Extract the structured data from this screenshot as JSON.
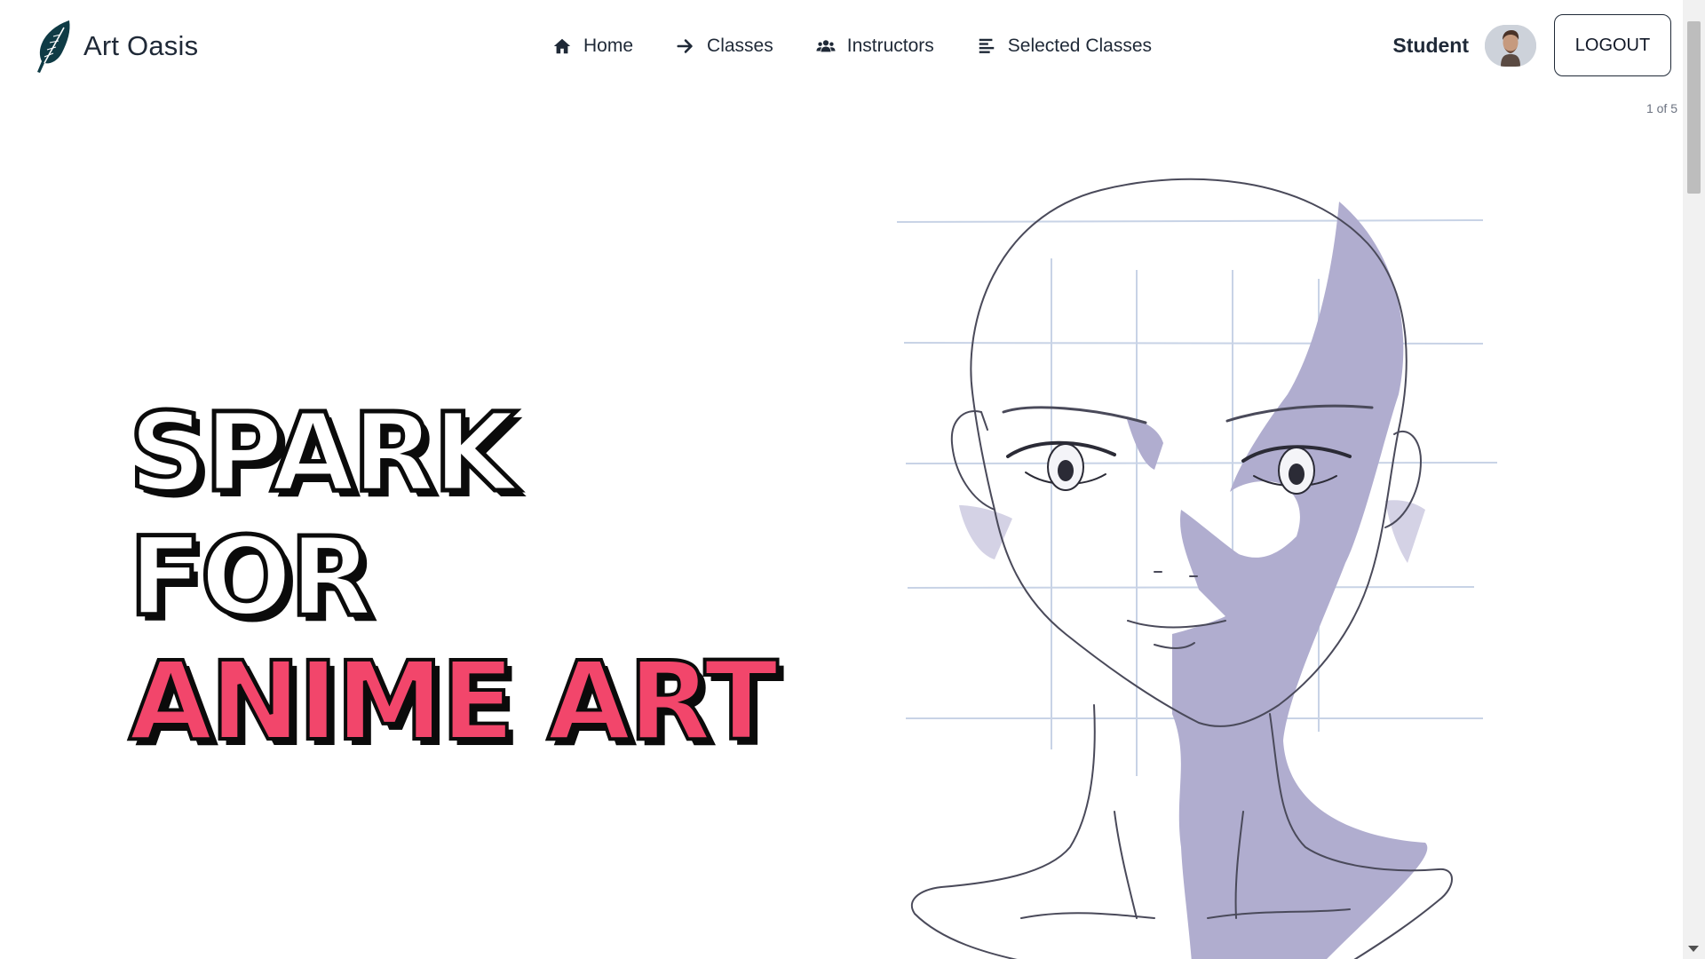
{
  "brand": {
    "name": "Art Oasis",
    "logo_icon": "feather-icon",
    "logo_color": "#0f3b45"
  },
  "nav": {
    "items": [
      {
        "label": "Home",
        "icon": "home-icon"
      },
      {
        "label": "Classes",
        "icon": "arrow-right-icon"
      },
      {
        "label": "Instructors",
        "icon": "users-icon"
      },
      {
        "label": "Selected Classes",
        "icon": "list-icon"
      }
    ]
  },
  "user": {
    "role_label": "Student",
    "avatar_icon": "avatar",
    "logout_label": "LOGOUT"
  },
  "carousel": {
    "counter": "1 of 5",
    "headline_lines": [
      "SPARK",
      "FOR",
      "ANIME ART"
    ],
    "accent_color": "#f2466b",
    "shadow_color": "#a9a7cc",
    "image": "anime-face-drawing"
  }
}
